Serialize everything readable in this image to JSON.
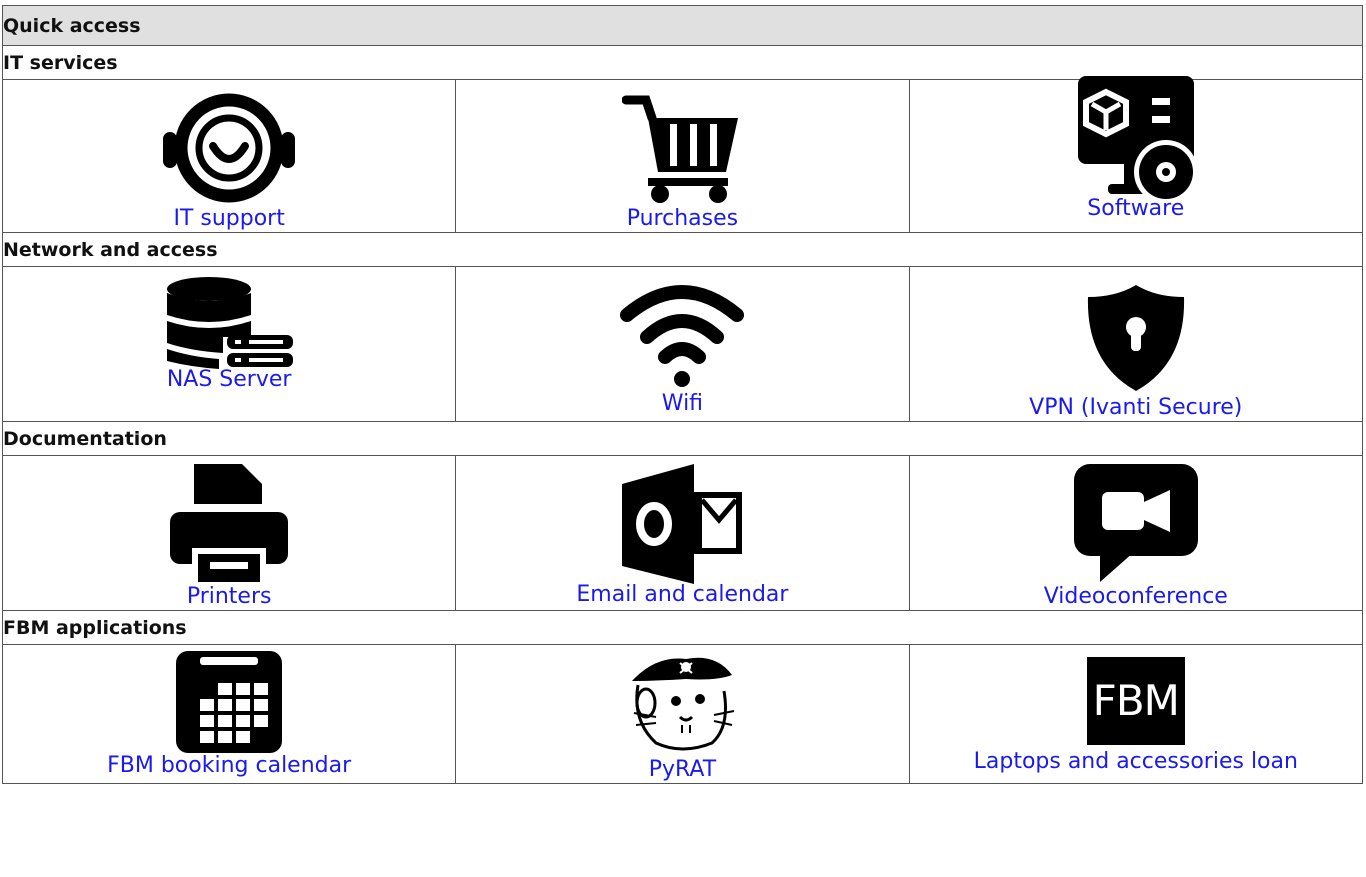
{
  "title": "Quick access",
  "sections": [
    {
      "heading": "IT services",
      "items": [
        {
          "label": "IT support",
          "icon": "headset-icon"
        },
        {
          "label": "Purchases",
          "icon": "shopping-cart-icon"
        },
        {
          "label": "Software",
          "icon": "software-monitor-icon"
        }
      ]
    },
    {
      "heading": "Network and access",
      "items": [
        {
          "label": "NAS Server",
          "icon": "database-server-icon"
        },
        {
          "label": "Wifi",
          "icon": "wifi-icon"
        },
        {
          "label": "VPN (Ivanti Secure)",
          "icon": "shield-keyhole-icon"
        }
      ]
    },
    {
      "heading": "Documentation",
      "items": [
        {
          "label": "Printers",
          "icon": "printer-icon"
        },
        {
          "label": "Email and calendar",
          "icon": "outlook-icon"
        },
        {
          "label": "Videoconference",
          "icon": "video-chat-icon"
        }
      ]
    },
    {
      "heading": "FBM applications",
      "items": [
        {
          "label": "FBM booking calendar",
          "icon": "calendar-icon"
        },
        {
          "label": "PyRAT",
          "icon": "pirate-rat-icon"
        },
        {
          "label": "Laptops and accessories loan",
          "icon": "fbm-logo",
          "logo_text": "FBM"
        }
      ]
    }
  ],
  "colors": {
    "link": "#1a1aee",
    "header_bg": "#e0e0e0",
    "border": "#555555",
    "icon": "#000000"
  }
}
